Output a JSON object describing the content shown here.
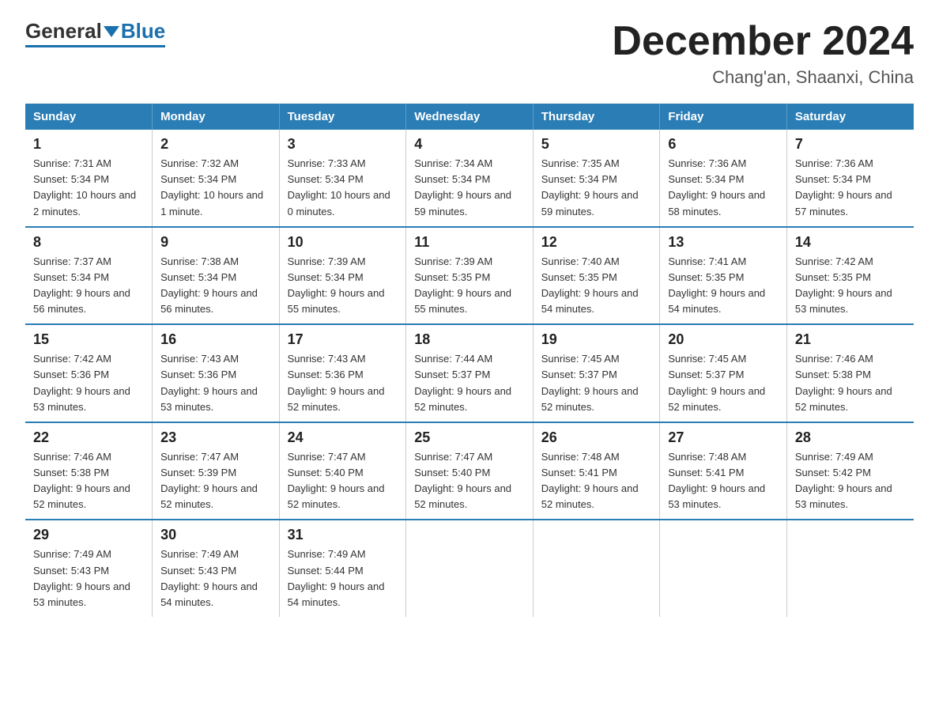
{
  "logo": {
    "general": "General",
    "blue": "Blue"
  },
  "title": {
    "month_year": "December 2024",
    "location": "Chang'an, Shaanxi, China"
  },
  "days_of_week": [
    "Sunday",
    "Monday",
    "Tuesday",
    "Wednesday",
    "Thursday",
    "Friday",
    "Saturday"
  ],
  "weeks": [
    [
      {
        "day": "1",
        "sunrise": "7:31 AM",
        "sunset": "5:34 PM",
        "daylight": "10 hours and 2 minutes."
      },
      {
        "day": "2",
        "sunrise": "7:32 AM",
        "sunset": "5:34 PM",
        "daylight": "10 hours and 1 minute."
      },
      {
        "day": "3",
        "sunrise": "7:33 AM",
        "sunset": "5:34 PM",
        "daylight": "10 hours and 0 minutes."
      },
      {
        "day": "4",
        "sunrise": "7:34 AM",
        "sunset": "5:34 PM",
        "daylight": "9 hours and 59 minutes."
      },
      {
        "day": "5",
        "sunrise": "7:35 AM",
        "sunset": "5:34 PM",
        "daylight": "9 hours and 59 minutes."
      },
      {
        "day": "6",
        "sunrise": "7:36 AM",
        "sunset": "5:34 PM",
        "daylight": "9 hours and 58 minutes."
      },
      {
        "day": "7",
        "sunrise": "7:36 AM",
        "sunset": "5:34 PM",
        "daylight": "9 hours and 57 minutes."
      }
    ],
    [
      {
        "day": "8",
        "sunrise": "7:37 AM",
        "sunset": "5:34 PM",
        "daylight": "9 hours and 56 minutes."
      },
      {
        "day": "9",
        "sunrise": "7:38 AM",
        "sunset": "5:34 PM",
        "daylight": "9 hours and 56 minutes."
      },
      {
        "day": "10",
        "sunrise": "7:39 AM",
        "sunset": "5:34 PM",
        "daylight": "9 hours and 55 minutes."
      },
      {
        "day": "11",
        "sunrise": "7:39 AM",
        "sunset": "5:35 PM",
        "daylight": "9 hours and 55 minutes."
      },
      {
        "day": "12",
        "sunrise": "7:40 AM",
        "sunset": "5:35 PM",
        "daylight": "9 hours and 54 minutes."
      },
      {
        "day": "13",
        "sunrise": "7:41 AM",
        "sunset": "5:35 PM",
        "daylight": "9 hours and 54 minutes."
      },
      {
        "day": "14",
        "sunrise": "7:42 AM",
        "sunset": "5:35 PM",
        "daylight": "9 hours and 53 minutes."
      }
    ],
    [
      {
        "day": "15",
        "sunrise": "7:42 AM",
        "sunset": "5:36 PM",
        "daylight": "9 hours and 53 minutes."
      },
      {
        "day": "16",
        "sunrise": "7:43 AM",
        "sunset": "5:36 PM",
        "daylight": "9 hours and 53 minutes."
      },
      {
        "day": "17",
        "sunrise": "7:43 AM",
        "sunset": "5:36 PM",
        "daylight": "9 hours and 52 minutes."
      },
      {
        "day": "18",
        "sunrise": "7:44 AM",
        "sunset": "5:37 PM",
        "daylight": "9 hours and 52 minutes."
      },
      {
        "day": "19",
        "sunrise": "7:45 AM",
        "sunset": "5:37 PM",
        "daylight": "9 hours and 52 minutes."
      },
      {
        "day": "20",
        "sunrise": "7:45 AM",
        "sunset": "5:37 PM",
        "daylight": "9 hours and 52 minutes."
      },
      {
        "day": "21",
        "sunrise": "7:46 AM",
        "sunset": "5:38 PM",
        "daylight": "9 hours and 52 minutes."
      }
    ],
    [
      {
        "day": "22",
        "sunrise": "7:46 AM",
        "sunset": "5:38 PM",
        "daylight": "9 hours and 52 minutes."
      },
      {
        "day": "23",
        "sunrise": "7:47 AM",
        "sunset": "5:39 PM",
        "daylight": "9 hours and 52 minutes."
      },
      {
        "day": "24",
        "sunrise": "7:47 AM",
        "sunset": "5:40 PM",
        "daylight": "9 hours and 52 minutes."
      },
      {
        "day": "25",
        "sunrise": "7:47 AM",
        "sunset": "5:40 PM",
        "daylight": "9 hours and 52 minutes."
      },
      {
        "day": "26",
        "sunrise": "7:48 AM",
        "sunset": "5:41 PM",
        "daylight": "9 hours and 52 minutes."
      },
      {
        "day": "27",
        "sunrise": "7:48 AM",
        "sunset": "5:41 PM",
        "daylight": "9 hours and 53 minutes."
      },
      {
        "day": "28",
        "sunrise": "7:49 AM",
        "sunset": "5:42 PM",
        "daylight": "9 hours and 53 minutes."
      }
    ],
    [
      {
        "day": "29",
        "sunrise": "7:49 AM",
        "sunset": "5:43 PM",
        "daylight": "9 hours and 53 minutes."
      },
      {
        "day": "30",
        "sunrise": "7:49 AM",
        "sunset": "5:43 PM",
        "daylight": "9 hours and 54 minutes."
      },
      {
        "day": "31",
        "sunrise": "7:49 AM",
        "sunset": "5:44 PM",
        "daylight": "9 hours and 54 minutes."
      },
      null,
      null,
      null,
      null
    ]
  ]
}
